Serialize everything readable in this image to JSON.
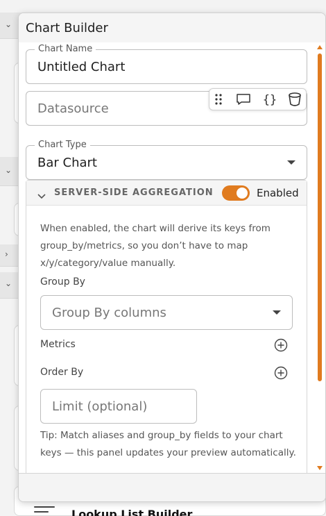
{
  "dialog": {
    "title": "Chart Builder"
  },
  "fields": {
    "chart_name": {
      "label": "Chart Name",
      "value": "Untitled Chart"
    },
    "datasource": {
      "placeholder": "Datasource"
    },
    "chart_type": {
      "label": "Chart Type",
      "value": "Bar Chart"
    }
  },
  "toolbar": {
    "icons": [
      "drag-handle-icon",
      "comment-icon",
      "braces-icon",
      "cylinder-icon"
    ]
  },
  "aggregation": {
    "title": "SERVER-SIDE AGGREGATION",
    "toggle_label": "Enabled",
    "toggle_on": true,
    "description": "When enabled, the chart will derive its keys from group_by/metrics, so you don’t have to map x/y/category/value manually.",
    "group_by_label": "Group By",
    "group_by_placeholder": "Group By columns",
    "metrics_label": "Metrics",
    "order_by_label": "Order By",
    "limit_placeholder": "Limit (optional)",
    "tip": "Tip: Match aliases and group_by fields to your chart keys — this panel updates your preview automatically."
  },
  "background": {
    "bottom_item": "Lookup List Builder"
  },
  "colors": {
    "accent": "#e07b1f"
  }
}
